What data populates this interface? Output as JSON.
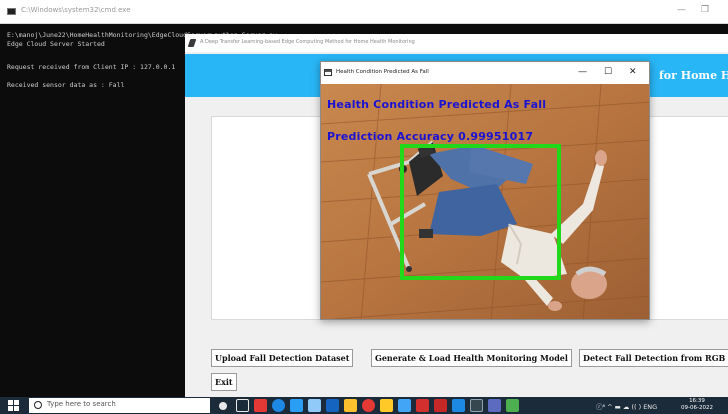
{
  "cmd": {
    "title": "C:\\Windows\\system32\\cmd.exe",
    "controls": {
      "minimize": "—",
      "maximize": "❐",
      "close": "✕"
    },
    "lines": [
      "E:\\manoj\\June22\\HomeHealthMonitoring\\EdgeCloudServer>python Server.py",
      "Edge Cloud Server Started",
      "Request received from Client IP : 127.0.0.1",
      "Received sensor data as : Fall"
    ]
  },
  "app": {
    "title": "A Deep Transfer Learning-based Edge Computing Method for Home Health Monitoring",
    "heading": "for Home Health Monitoring",
    "buttons": {
      "upload": "Upload Fall Detection Dataset",
      "generate": "Generate & Load Health Monitoring Model",
      "detect": "Detect Fall Detection from RGB Images",
      "exit": "Exit"
    }
  },
  "result_window": {
    "title": "Health Condition Predicted As Fall",
    "controls": {
      "minimize": "—",
      "maximize": "☐",
      "close": "✕"
    },
    "overlay_line1": "Health Condition Predicted As Fall",
    "overlay_line2": "Prediction Accuracy 0.99951017",
    "overlay_text_color": "#1b12d4",
    "box_color": "#22d81a"
  },
  "taskbar": {
    "search_placeholder": "Type here to search",
    "tray": "ⓡ⁸ ^ ▬ ☁ ((  ) ENG",
    "time": "16:39",
    "date": "09-06-2022",
    "apps": [
      "task-view-icon",
      "folder-icon",
      "chrome-icon",
      "edge-icon",
      "store-icon",
      "gallery-icon",
      "app-blue-icon",
      "python-icon",
      "chrome2-icon",
      "files-icon",
      "pdf-icon",
      "adobe-icon",
      "editor-icon",
      "terminal-icon",
      "photos-icon",
      "python-run-icon"
    ]
  },
  "colors": {
    "cmd_bg": "#0c0c0c",
    "banner": "#29b6f6",
    "taskbar": "#1c2b3a"
  }
}
